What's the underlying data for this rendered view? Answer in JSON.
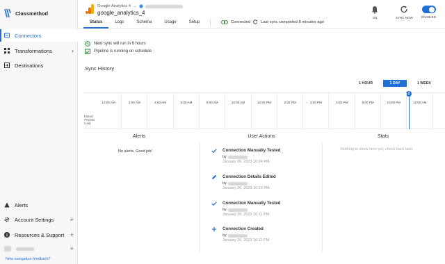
{
  "sidebar": {
    "brand": "Classmethod",
    "items": [
      {
        "label": "Connectors",
        "icon": "connectors-icon",
        "active": true
      },
      {
        "label": "Transformations",
        "icon": "transformations-icon"
      },
      {
        "label": "Destinations",
        "icon": "destinations-icon"
      }
    ],
    "bottom_items": [
      {
        "label": "Alerts",
        "icon": "alert-icon"
      },
      {
        "label": "Account Settings",
        "icon": "gear-icon"
      },
      {
        "label": "Resources & Support",
        "icon": "info-icon"
      }
    ],
    "expand_glyph": "+",
    "feedback_link": "New navigation feedback?"
  },
  "header": {
    "breadcrumb": "Google Analytics 4",
    "arrow": "→",
    "title": "google_analytics_4",
    "tabs": [
      "Status",
      "Logs",
      "Schema",
      "Usage",
      "Setup"
    ],
    "active_tab": "Status",
    "connected": "Connected",
    "last_sync": "Last sync completed 8 minutes ago",
    "controls": {
      "on_label": "ON",
      "sync_label": "SYNC NOW",
      "enabled_label": "ENABLED"
    }
  },
  "info": {
    "next_sync": "Next sync will run in 6 hours",
    "pipeline": "Pipeline is running on schedule"
  },
  "sync_history": {
    "title": "Sync History",
    "ranges": [
      "1 HOUR",
      "1 DAY",
      "1 WEEK"
    ],
    "active_range": "1 DAY",
    "ticks": [
      "12:00 AM",
      "2:00 AM",
      "4:00 AM",
      "6:00 AM",
      "8:00 AM",
      "10:00 AM",
      "12:00 PM",
      "2:00 PM",
      "4:00 PM",
      "6:00 PM",
      "8:00 PM",
      "10:00 PM",
      "12:00 AM"
    ],
    "row_labels": [
      "Extract",
      "Process",
      "Load"
    ],
    "marker_count": "2"
  },
  "alerts": {
    "title": "Alerts",
    "empty": "No alerts. Good job!"
  },
  "user_actions": {
    "title": "User Actions",
    "by_label": "by",
    "items": [
      {
        "title": "Connection Manually Tested",
        "date": "January 26, 2023 10:24 PM",
        "icon": "check-icon"
      },
      {
        "title": "Connection Details Edited",
        "date": "January 26, 2023 10:23 PM",
        "icon": "pencil-icon"
      },
      {
        "title": "Connection Manually Tested",
        "date": "January 26, 2023 10:11 PM",
        "icon": "check-icon"
      },
      {
        "title": "Connection Created",
        "date": "January 26, 2023 10:11 PM",
        "icon": "plus-icon"
      }
    ]
  },
  "stats": {
    "title": "Stats",
    "empty": "Nothing to show here yet, check back later"
  },
  "colors": {
    "accent": "#1f6fd6",
    "success": "#2e8b3a",
    "ga_orange": "#f9ab00",
    "ga_dark": "#e37400"
  }
}
